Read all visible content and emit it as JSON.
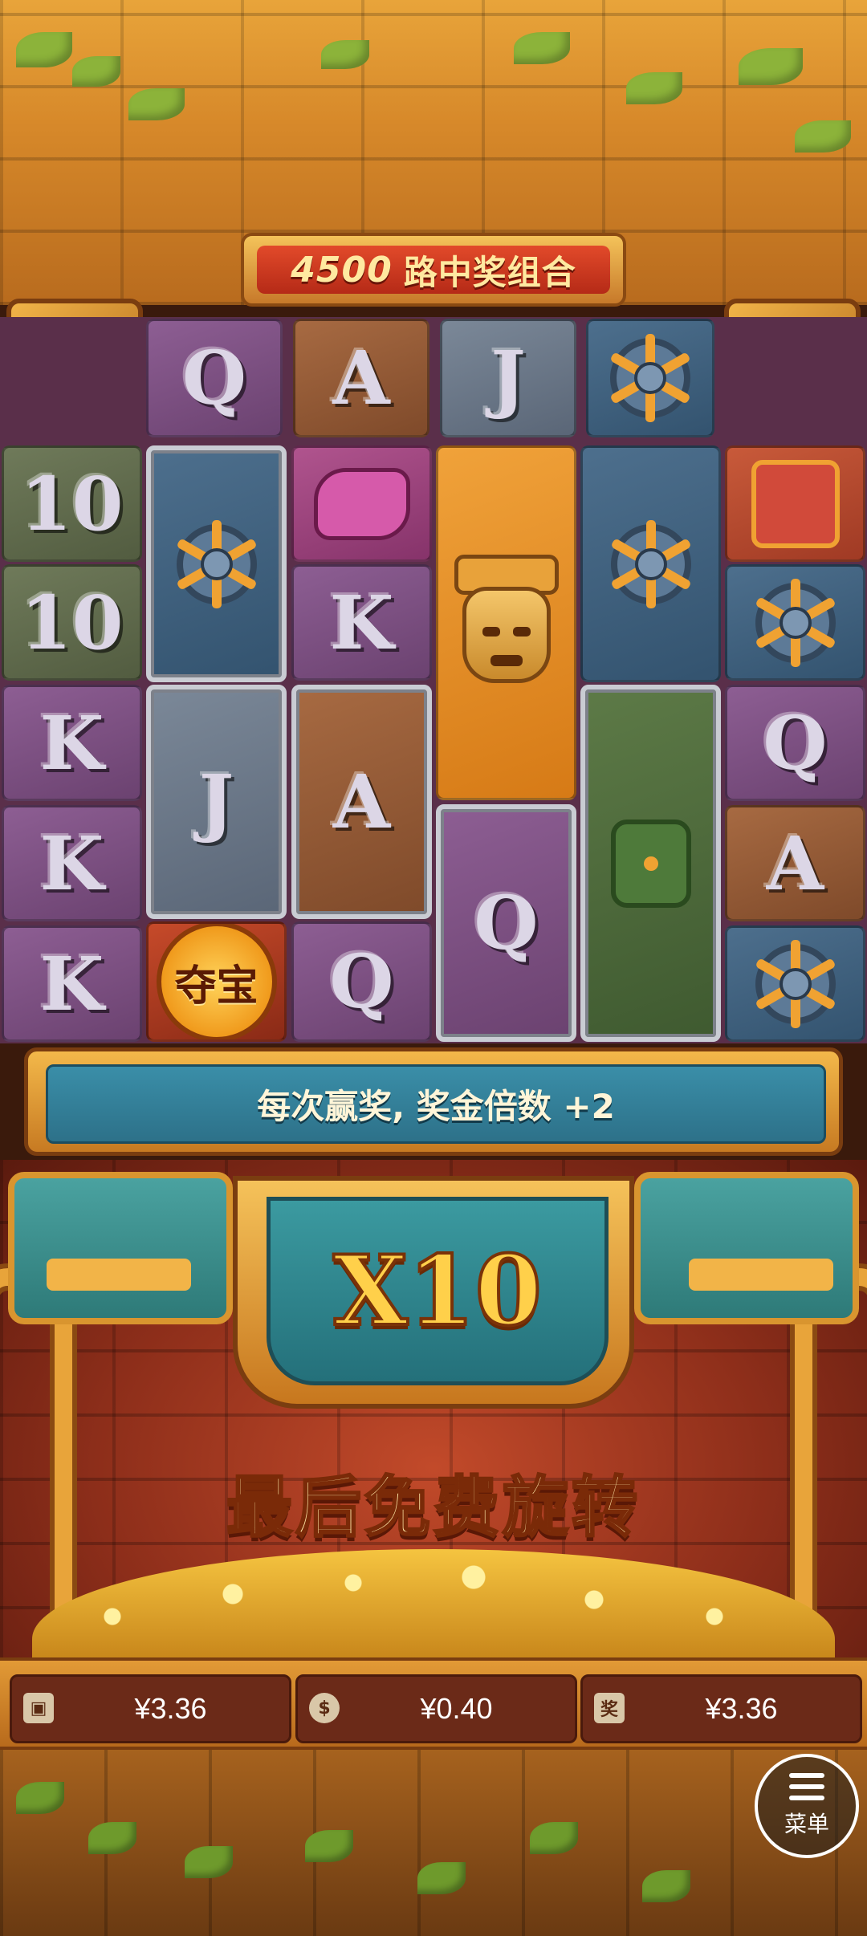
{
  "header": {
    "ways_count": "4500",
    "ways_label": "路中奖组合"
  },
  "reels": {
    "row0": [
      "Q",
      "A",
      "J",
      "sun-disc"
    ],
    "col0": [
      "10",
      "10",
      "K",
      "K",
      "K"
    ],
    "col1": [
      "sun-disc",
      "J",
      "夺宝"
    ],
    "col2": [
      "serpent-head",
      "K",
      "A",
      "Q"
    ],
    "col3": [
      "golden-mask",
      "Q"
    ],
    "col4": [
      "sun-disc",
      "jade-idol"
    ],
    "col5": [
      "red-mask",
      "sun-disc",
      "Q",
      "A",
      "sun-disc"
    ]
  },
  "info_banner": {
    "text": "每次赢奖, 奖金倍数 +2"
  },
  "multiplier": {
    "value": "X10"
  },
  "final_spin": {
    "text": "最后免费旋转"
  },
  "status": {
    "balance": "¥3.36",
    "bet": "¥0.40",
    "win": "¥3.36",
    "win_icon_text": "奖"
  },
  "menu": {
    "label": "菜单"
  }
}
